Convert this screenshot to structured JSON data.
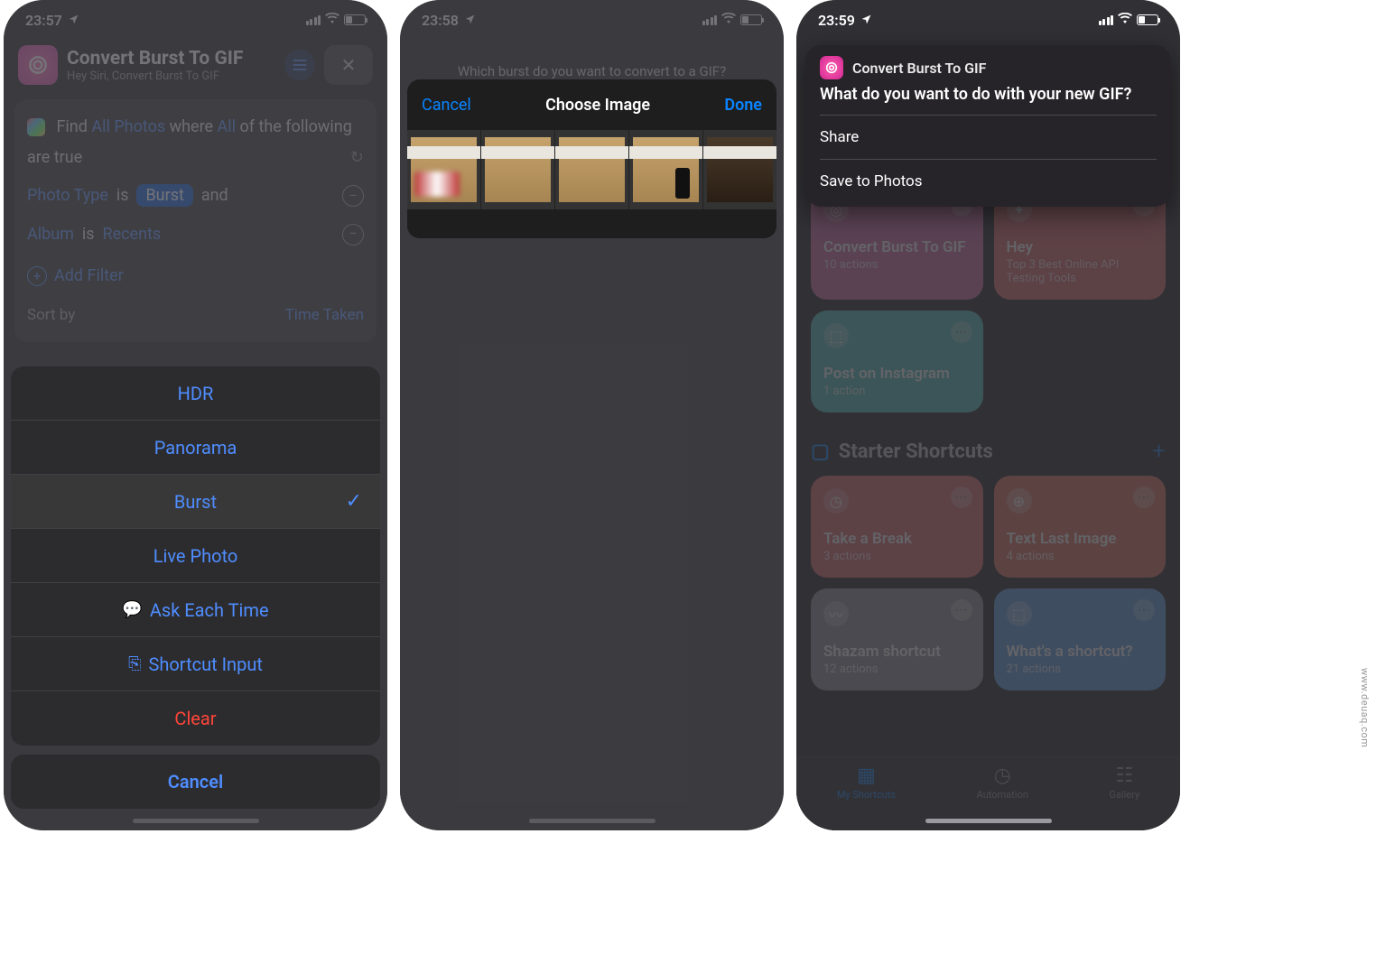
{
  "watermark": "www.deuaq.com",
  "phone1": {
    "time": "23:57",
    "title": "Convert Burst To GIF",
    "subtitle": "Hey Siri, Convert Burst To GIF",
    "card": {
      "find": "Find",
      "allPhotos": "All Photos",
      "where": "where",
      "all": "All",
      "ofFollowing": "of the following are true",
      "photoType": "Photo Type",
      "is1": "is",
      "burst": "Burst",
      "and": "and",
      "album": "Album",
      "is2": "is",
      "recents": "Recents",
      "addFilter": "Add Filter",
      "sortBy": "Sort by",
      "sortVal": "Time Taken"
    },
    "picker": {
      "hdr": "HDR",
      "panorama": "Panorama",
      "burst": "Burst",
      "livePhoto": "Live Photo",
      "askEachTime": "Ask Each Time",
      "shortcutInput": "Shortcut Input",
      "clear": "Clear",
      "cancel": "Cancel"
    }
  },
  "phone2": {
    "time": "23:58",
    "prompt": "Which burst do you want to convert to a GIF?",
    "cancel": "Cancel",
    "title": "Choose Image",
    "done": "Done"
  },
  "phone3": {
    "time": "23:59",
    "notif": {
      "app": "Convert Burst To GIF",
      "question": "What do you want to do with your new GIF?",
      "share": "Share",
      "save": "Save to Photos"
    },
    "tiles": {
      "t1": {
        "title": "Convert Burst To GIF",
        "sub": "10 actions"
      },
      "t2": {
        "title": "Hey",
        "sub": "Top 3 Best Online API Testing Tools"
      },
      "t3": {
        "title": "Post on Instagram",
        "sub": "1 action"
      },
      "t4": {
        "title": "Take a Break",
        "sub": "3 actions"
      },
      "t5": {
        "title": "Text Last Image",
        "sub": "4 actions"
      },
      "t6": {
        "title": "Shazam shortcut",
        "sub": "12 actions"
      },
      "t7": {
        "title": "What's a shortcut?",
        "sub": "21 actions"
      }
    },
    "section": "Starter Shortcuts",
    "tabs": {
      "shortcuts": "My Shortcuts",
      "automation": "Automation",
      "gallery": "Gallery"
    }
  }
}
